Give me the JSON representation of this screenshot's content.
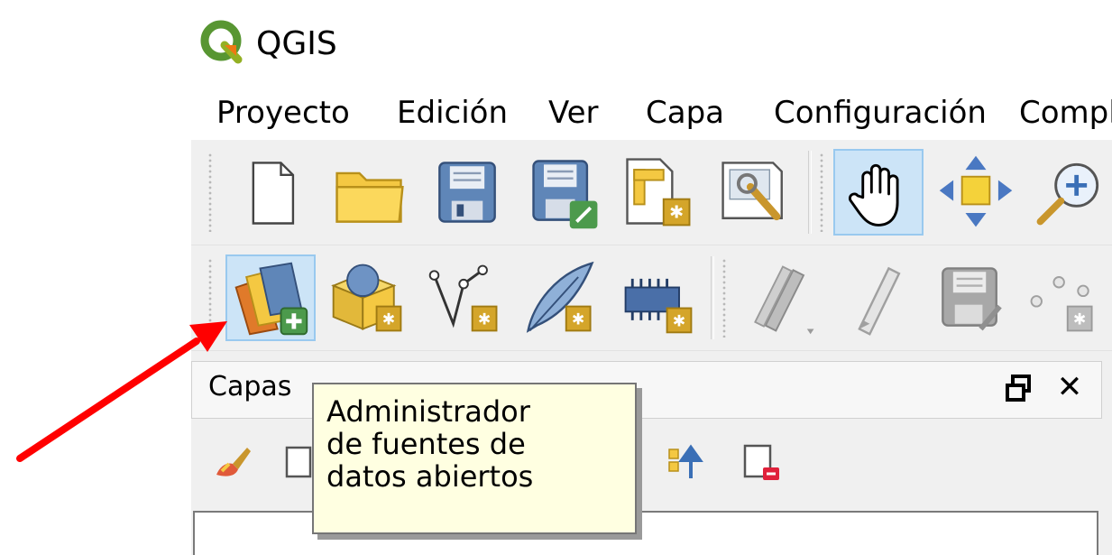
{
  "window": {
    "title": "QGIS"
  },
  "menu": {
    "items": [
      {
        "label": "Proyecto"
      },
      {
        "label": "Edición"
      },
      {
        "label": "Ver"
      },
      {
        "label": "Capa"
      },
      {
        "label": "Configuración"
      },
      {
        "label": "Compl"
      }
    ]
  },
  "toolbar1": {
    "buttons": [
      {
        "icon": "new-project-icon"
      },
      {
        "icon": "open-project-icon"
      },
      {
        "icon": "save-project-icon"
      },
      {
        "icon": "save-as-icon"
      },
      {
        "icon": "new-print-layout-icon"
      },
      {
        "icon": "layout-manager-icon"
      },
      {
        "icon": "pan-hand-icon",
        "active": true
      },
      {
        "icon": "pan-to-selection-icon"
      },
      {
        "icon": "zoom-in-icon"
      }
    ]
  },
  "toolbar2": {
    "buttons": [
      {
        "icon": "data-source-manager-icon",
        "active": true
      },
      {
        "icon": "new-geopackage-layer-icon"
      },
      {
        "icon": "new-shapefile-layer-icon"
      },
      {
        "icon": "new-spatialite-layer-icon"
      },
      {
        "icon": "new-temporary-layer-icon"
      },
      {
        "icon": "current-edits-icon"
      },
      {
        "icon": "toggle-editing-icon"
      },
      {
        "icon": "save-layer-edits-icon"
      },
      {
        "icon": "digitize-points-icon"
      }
    ]
  },
  "layers_panel": {
    "title": "Capas",
    "tools": [
      {
        "icon": "style-paintbrush-icon"
      },
      {
        "icon": "add-group-icon"
      },
      {
        "icon": "move-up-icon"
      },
      {
        "icon": "remove-layer-icon"
      }
    ]
  },
  "tooltip": {
    "text": "Administrador\nde fuentes de\ndatos abiertos"
  },
  "colors": {
    "accent_active": "#cce4f7",
    "arrow": "#ff0000",
    "tooltip_bg": "#ffffe1"
  }
}
